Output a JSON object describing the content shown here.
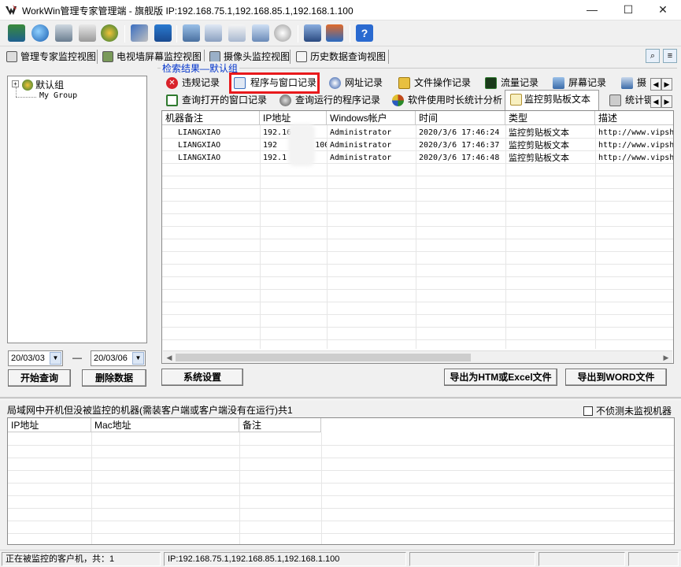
{
  "app": {
    "title": "WorkWin管理专家管理端 - 旗舰版 IP:192.168.75.1,192.168.85.1,192.168.1.100"
  },
  "window_controls": {
    "minimize": "—",
    "maximize": "☐",
    "close": "✕"
  },
  "view_tabs": [
    {
      "label": "管理专家监控视图",
      "icon": "monitor-view-icon"
    },
    {
      "label": "电视墙屏幕监控视图",
      "icon": "tv-wall-icon"
    },
    {
      "label": "摄像头监控视图",
      "icon": "camera-icon"
    },
    {
      "label": "历史数据查询视图",
      "icon": "history-icon"
    }
  ],
  "tree": {
    "items": [
      {
        "label": "默认组",
        "icon": "group-icon"
      },
      {
        "label": "My Group"
      }
    ]
  },
  "filters": {
    "date_from": "20/03/03",
    "date_sep": "—",
    "date_to": "20/03/06",
    "start_query": "开始查询",
    "delete_data": "删除数据"
  },
  "results_group": {
    "label": "检索结果—默认组"
  },
  "tabs_row1": [
    {
      "label": "违规记录",
      "icon": "violation-icon",
      "color": "#d9222a"
    },
    {
      "label": "程序与窗口记录",
      "icon": "program-window-icon",
      "color": "#3a70c0",
      "highlighted": true
    },
    {
      "label": "网址记录",
      "icon": "url-icon",
      "color": "#2a56a8"
    },
    {
      "label": "文件操作记录",
      "icon": "file-op-icon",
      "color": "#c08a1a"
    },
    {
      "label": "流量记录",
      "icon": "traffic-icon",
      "color": "#2f7a2f"
    },
    {
      "label": "屏幕记录",
      "icon": "screen-icon",
      "color": "#3a6aa8"
    },
    {
      "label": "摄",
      "icon": "camera-record-icon",
      "color": "#3a6aa8"
    }
  ],
  "tabs_row2": [
    {
      "label": "查询打开的窗口记录",
      "icon": "open-window-icon",
      "color": "#2f7a2f"
    },
    {
      "label": "查询运行的程序记录",
      "icon": "run-program-icon",
      "color": "#555555"
    },
    {
      "label": "软件使用时长统计分析",
      "icon": "software-time-icon",
      "color": "#c04a1a"
    },
    {
      "label": "监控剪贴板文本",
      "icon": "clipboard-icon",
      "color": "#e0c060",
      "highlighted": true,
      "active": true
    },
    {
      "label": "统计键",
      "icon": "keyboard-stats-icon",
      "color": "#666666"
    }
  ],
  "table": {
    "columns": [
      "机器备注",
      "IP地址",
      "Windows帐户",
      "时间",
      "类型",
      "描述"
    ],
    "rows": [
      [
        "LIANGXIAO",
        "192.16",
        "Administrator",
        "2020/3/6 17:46:24",
        "监控剪贴板文本",
        "http://www.vipshe"
      ],
      [
        "LIANGXIAO",
        "192        100",
        "Administrator",
        "2020/3/6 17:46:37",
        "监控剪贴板文本",
        "http://www.vipshe"
      ],
      [
        "LIANGXIAO",
        "192.1",
        "Administrator",
        "2020/3/6 17:46:48",
        "监控剪贴板文本",
        "http://www.vipshe"
      ]
    ]
  },
  "actions": {
    "system_settings": "系统设置",
    "export_htm_excel": "导出为HTM或Excel文件",
    "export_word": "导出到WORD文件"
  },
  "unmonitored": {
    "title": "局域网中开机但没被监控的机器(需装客户端或客户端没有在运行)共1",
    "checkbox_label": "不侦测未监视机器",
    "columns": [
      "IP地址",
      "Mac地址",
      "备注"
    ]
  },
  "status_bar": {
    "clients": "正在被监控的客户机，共：1",
    "ips": "IP:192.168.75.1,192.168.85.1,192.168.1.100"
  },
  "toolbar_icons": [
    "books-icon",
    "globe-icon",
    "camera-settings-icon",
    "chart-icon",
    "users-icon",
    "tools-icon",
    "tag-icon",
    "monitor-icon",
    "email-icon",
    "document-icon",
    "copy-icon",
    "disc-icon",
    "notebook-icon",
    "projector-icon",
    "help-icon"
  ]
}
